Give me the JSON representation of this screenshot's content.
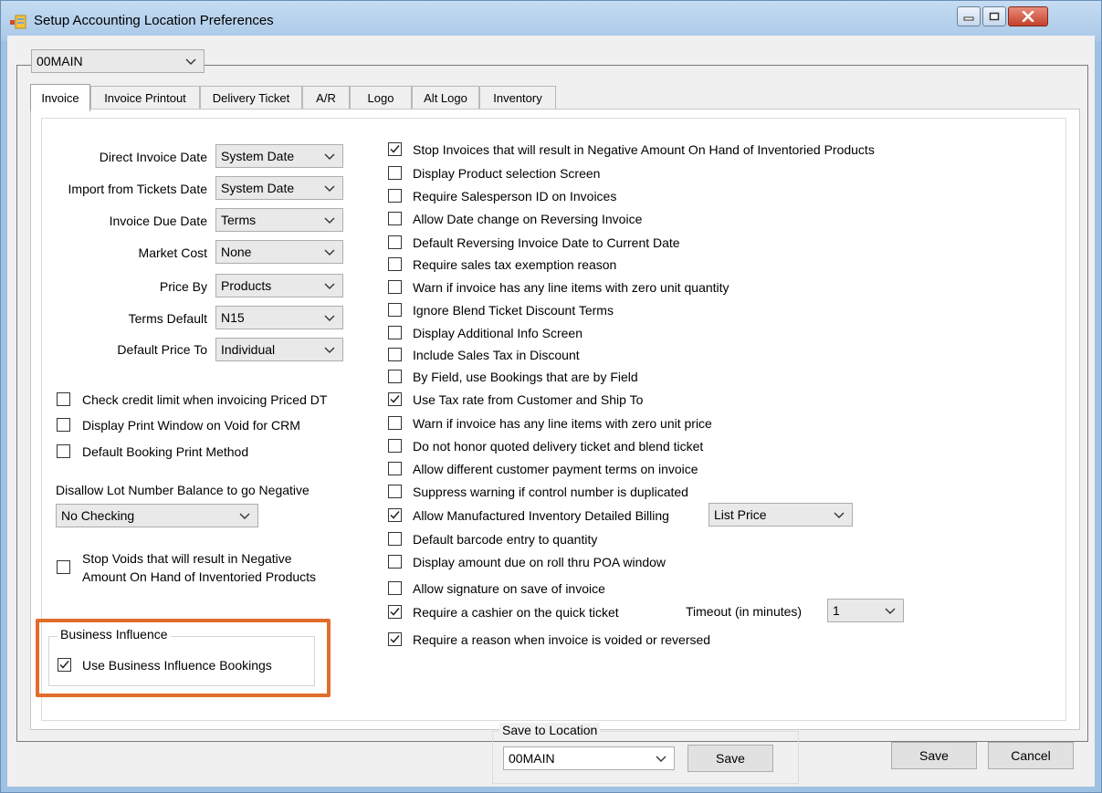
{
  "window": {
    "title": "Setup Accounting Location Preferences"
  },
  "location_select": {
    "value": "00MAIN"
  },
  "tabs": [
    {
      "label": "Invoice"
    },
    {
      "label": "Invoice Printout"
    },
    {
      "label": "Delivery Ticket"
    },
    {
      "label": "A/R"
    },
    {
      "label": "Logo"
    },
    {
      "label": "Alt Logo"
    },
    {
      "label": "Inventory"
    }
  ],
  "fields": [
    {
      "label": "Direct Invoice Date",
      "value": "System Date"
    },
    {
      "label": "Import from Tickets Date",
      "value": "System Date"
    },
    {
      "label": "Invoice Due Date",
      "value": "Terms"
    },
    {
      "label": "Market Cost",
      "value": "None"
    },
    {
      "label": "Price By",
      "value": "Products"
    },
    {
      "label": "Terms Default",
      "value": "N15"
    },
    {
      "label": "Default Price To",
      "value": "Individual"
    }
  ],
  "left_checks": [
    {
      "label": "Check credit limit when invoicing Priced DT",
      "checked": false
    },
    {
      "label": "Display Print Window on Void for CRM",
      "checked": false
    },
    {
      "label": "Default Booking Print Method",
      "checked": false
    }
  ],
  "lot_balance": {
    "label": "Disallow Lot Number Balance to go Negative",
    "value": "No Checking"
  },
  "stop_voids": {
    "line1": "Stop Voids that will result in Negative",
    "line2": "Amount On Hand of Inventoried Products",
    "checked": false
  },
  "business_influence": {
    "title": "Business Influence",
    "check_label": "Use Business Influence Bookings",
    "checked": true
  },
  "right_checks": [
    {
      "label": "Stop Invoices that will result in Negative Amount On Hand of Inventoried Products",
      "checked": true
    },
    {
      "label": "Display Product selection Screen",
      "checked": false
    },
    {
      "label": "Require Salesperson ID on Invoices",
      "checked": false
    },
    {
      "label": "Allow Date change on Reversing Invoice",
      "checked": false
    },
    {
      "label": "Default Reversing Invoice Date to Current Date",
      "checked": false
    },
    {
      "label": "Require sales tax exemption reason",
      "checked": false
    },
    {
      "label": "Warn if invoice has any line items with zero unit quantity",
      "checked": false
    },
    {
      "label": "Ignore Blend Ticket Discount Terms",
      "checked": false
    },
    {
      "label": "Display Additional Info Screen",
      "checked": false
    },
    {
      "label": "Include Sales Tax in Discount",
      "checked": false
    },
    {
      "label": "By Field, use Bookings that are by Field",
      "checked": false
    },
    {
      "label": "Use Tax rate from Customer and Ship To",
      "checked": true
    },
    {
      "label": "Warn if invoice has any line items with zero unit price",
      "checked": false
    },
    {
      "label": "Do not honor quoted delivery ticket and blend ticket",
      "checked": false
    },
    {
      "label": "Allow different customer payment terms on invoice",
      "checked": false
    },
    {
      "label": "Suppress warning if control number is duplicated",
      "checked": false
    },
    {
      "label": "Allow Manufactured Inventory Detailed Billing",
      "checked": true
    },
    {
      "label": "Default barcode entry to quantity",
      "checked": false
    },
    {
      "label": "Display amount due on roll thru POA window",
      "checked": false
    },
    {
      "label": "Allow signature on save of invoice",
      "checked": false
    },
    {
      "label": "Require a cashier on the quick ticket",
      "checked": true
    },
    {
      "label": "Require a reason when invoice is voided or reversed",
      "checked": true
    }
  ],
  "detailed_billing_select": {
    "value": "List Price"
  },
  "timeout": {
    "label": "Timeout (in minutes)",
    "value": "1"
  },
  "save_to_location": {
    "title": "Save to Location",
    "value": "00MAIN",
    "button": "Save"
  },
  "footer": {
    "save": "Save",
    "cancel": "Cancel"
  },
  "colors": {
    "highlight": "#e06d2a",
    "titlebar": "#a9c8e8"
  }
}
